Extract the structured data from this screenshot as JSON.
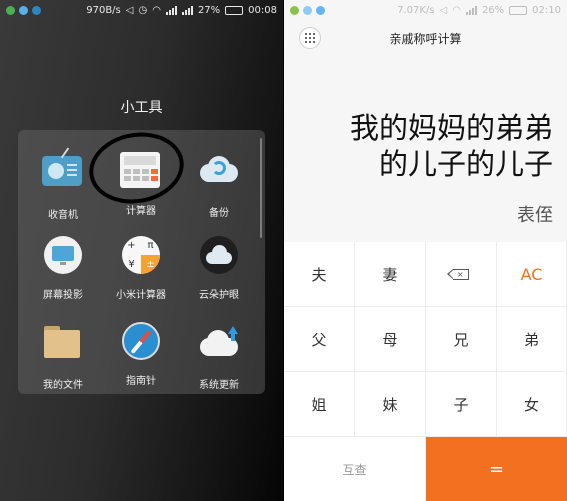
{
  "left_phone": {
    "status": {
      "speed": "970B/s",
      "battery": "27%",
      "battery_level": 0.27,
      "time": "00:08"
    },
    "folder_title": "小工具",
    "apps": [
      {
        "label": "收音机",
        "icon": "radio-icon"
      },
      {
        "label": "计算器",
        "icon": "calculator-icon"
      },
      {
        "label": "备份",
        "icon": "backup-cloud-icon"
      },
      {
        "label": "屏幕投影",
        "icon": "screen-projection-icon"
      },
      {
        "label": "小米计算器",
        "icon": "mi-calculator-icon"
      },
      {
        "label": "云朵护眼",
        "icon": "cloud-eye-icon"
      },
      {
        "label": "我的文件",
        "icon": "folder-icon"
      },
      {
        "label": "指南针",
        "icon": "compass-icon"
      },
      {
        "label": "系统更新",
        "icon": "system-update-icon"
      }
    ]
  },
  "right_phone": {
    "status": {
      "speed": "7.07K/s",
      "battery": "26%",
      "battery_level": 0.26,
      "time": "02:10"
    },
    "app_title": "亲戚称呼计算",
    "expression_line1": "我的妈妈的弟弟",
    "expression_line2": "的儿子的儿子",
    "result": "表侄",
    "keys": [
      {
        "label": "夫"
      },
      {
        "label": "妻"
      },
      {
        "label": "",
        "icon": "backspace-icon"
      },
      {
        "label": "AC"
      },
      {
        "label": "父"
      },
      {
        "label": "母"
      },
      {
        "label": "兄"
      },
      {
        "label": "弟"
      },
      {
        "label": "姐"
      },
      {
        "label": "妹"
      },
      {
        "label": "子"
      },
      {
        "label": "女"
      }
    ],
    "check_key": "互查",
    "equals_key": "=",
    "colors": {
      "accent": "#f37021"
    }
  }
}
